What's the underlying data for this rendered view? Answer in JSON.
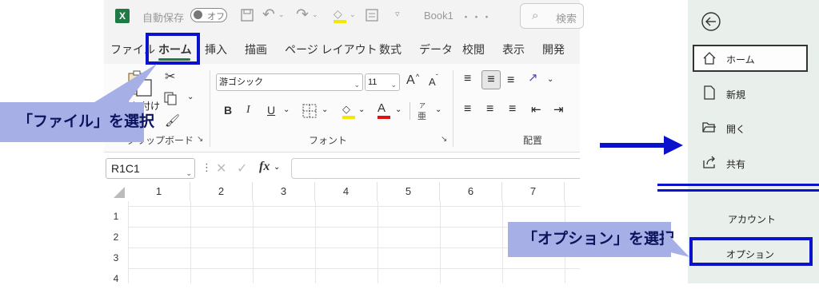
{
  "excel": {
    "titlebar": {
      "autosave_label": "自動保存",
      "autosave_state": "オフ",
      "filename": "Book1",
      "filename_suffix": "・・・",
      "search_label": "検索"
    },
    "tabs": [
      "ファイル",
      "ホーム",
      "挿入",
      "描画",
      "ページ レイアウト",
      "数式",
      "データ",
      "校閲",
      "表示",
      "開発"
    ],
    "active_tab": "ホーム",
    "ribbon": {
      "paste_label": "貼り付け",
      "clipboard_group": "クリップボード",
      "font_name": "游ゴシック",
      "font_size": "11",
      "grow_font": "A",
      "shrink_font": "A",
      "bold": "B",
      "italic": "I",
      "underline": "U",
      "phonetic": "亜",
      "font_group": "フォント",
      "alignment_group": "配置"
    },
    "formula_bar": {
      "name_box": "R1C1",
      "fx_label": "fx",
      "formula": ""
    },
    "grid": {
      "column_headers": [
        "1",
        "2",
        "3",
        "4",
        "5",
        "6",
        "7"
      ],
      "row_headers": [
        "1",
        "2",
        "3",
        "4"
      ]
    }
  },
  "backstage": {
    "items": [
      {
        "label": "ホーム",
        "icon": "home-icon"
      },
      {
        "label": "新規",
        "icon": "new-file-icon"
      },
      {
        "label": "開く",
        "icon": "open-folder-icon"
      },
      {
        "label": "共有",
        "icon": "share-icon"
      },
      {
        "label": "アカウント",
        "icon": ""
      },
      {
        "label": "オプション",
        "icon": ""
      }
    ]
  },
  "annotations": {
    "file_callout": "「ファイル」を選択",
    "options_callout": "「オプション」を選択"
  },
  "colors": {
    "highlight_border": "#0a12cc",
    "arrow": "#0a12cc",
    "callout_bg": "#a7b0e6",
    "excel_green": "#1f7a45",
    "backstage_bg": "#e9efea"
  }
}
